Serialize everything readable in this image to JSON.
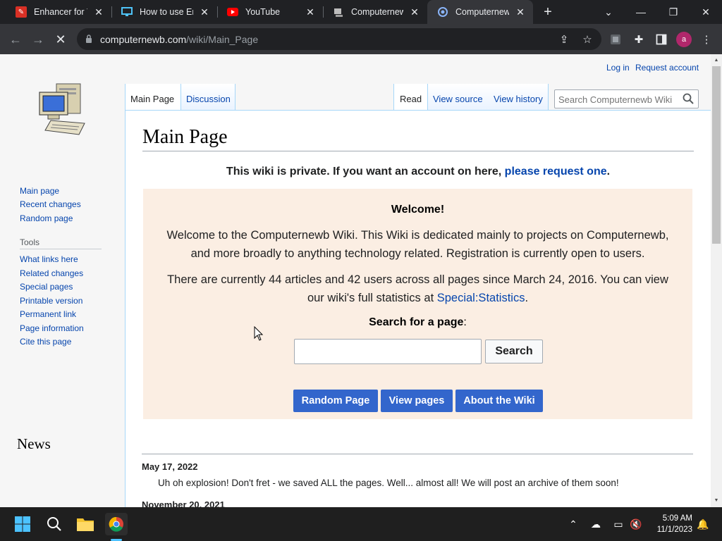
{
  "browser": {
    "tabs": [
      {
        "title": "Enhancer for YouTube",
        "favicon": "enhancer-icon"
      },
      {
        "title": "How to use Enhancer",
        "favicon": "monitor-icon"
      },
      {
        "title": "YouTube",
        "favicon": "youtube-icon"
      },
      {
        "title": "Computernewb",
        "favicon": "computernewb-icon"
      },
      {
        "title": "Computernewb",
        "favicon": "loading-icon",
        "active": true
      }
    ],
    "url_host": "computernewb.com",
    "url_path": "/wiki/Main_Page",
    "profile_initial": "a"
  },
  "wiki": {
    "personal": {
      "login": "Log in",
      "request_account": "Request account"
    },
    "sidebar": {
      "nav": [
        "Main page",
        "Recent changes",
        "Random page"
      ],
      "tools_heading": "Tools",
      "tools": [
        "What links here",
        "Related changes",
        "Special pages",
        "Printable version",
        "Permanent link",
        "Page information",
        "Cite this page"
      ]
    },
    "tabs": {
      "main_page": "Main Page",
      "discussion": "Discussion",
      "read": "Read",
      "view_source": "View source",
      "view_history": "View history"
    },
    "search_placeholder": "Search Computernewb Wiki",
    "title": "Main Page",
    "notice_text": "This wiki is private. If you want an account on here, ",
    "notice_link": "please request one",
    "notice_end": ".",
    "welcome": {
      "title": "Welcome!",
      "para1": "Welcome to the Computernewb Wiki. This Wiki is dedicated mainly to projects on Computernewb, and more broadly to anything technology related. Registration is currently open to users.",
      "para2_text": "There are currently 44 articles and 42 users across all pages since March 24, 2016. You can view our wiki's full statistics at ",
      "para2_link": "Special:Statistics",
      "para2_end": ".",
      "search_label": "Search for a page",
      "search_colon": ":",
      "search_button": "Search",
      "buttons": [
        "Random Page",
        "View pages",
        "About the Wiki"
      ]
    },
    "news": {
      "heading": "News",
      "items": [
        {
          "date": "May 17, 2022",
          "text": "Uh oh explosion! Don't fret - we saved ALL the pages. Well... almost all! We will post an archive of them soon!"
        },
        {
          "date": "November 20, 2021",
          "text": ""
        }
      ]
    }
  },
  "taskbar": {
    "time": "5:09 AM",
    "date": "11/1/2023"
  }
}
